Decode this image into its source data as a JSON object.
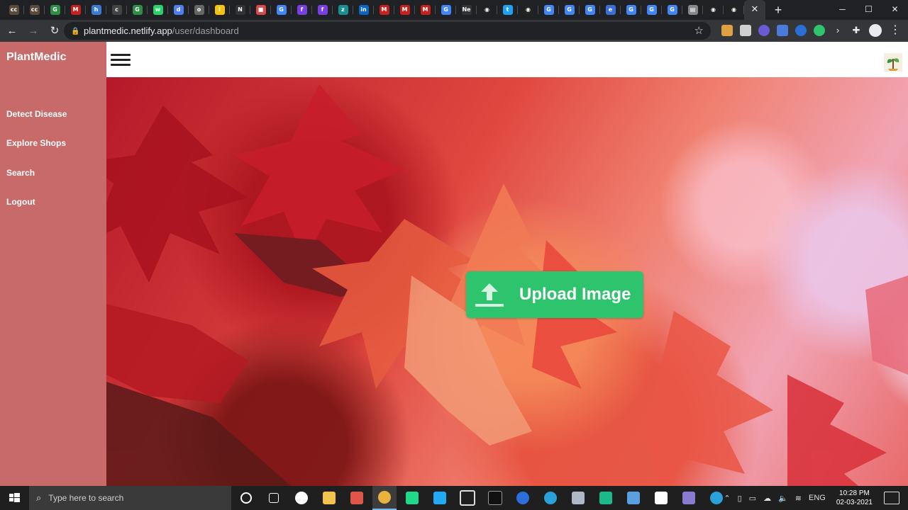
{
  "browser": {
    "active_tab_close": "✕",
    "new_tab": "+",
    "url_host": "plantmedic.netlify.app",
    "url_path": "/user/dashboard",
    "window_controls": [
      "─",
      "☐",
      "✕"
    ],
    "tab_favicons": [
      {
        "label": "cc",
        "color": "#5a4a3a"
      },
      {
        "label": "cc",
        "color": "#5a4a3a"
      },
      {
        "label": "G",
        "color": "#2f8d46"
      },
      {
        "label": "M",
        "color": "#c5221f"
      },
      {
        "label": "h",
        "color": "#3a7bd5"
      },
      {
        "label": "c",
        "color": "#444"
      },
      {
        "label": "G",
        "color": "#2f8d46"
      },
      {
        "label": "w",
        "color": "#25d366"
      },
      {
        "label": "d",
        "color": "#4f7df3"
      },
      {
        "label": "o",
        "color": "#666"
      },
      {
        "label": "i",
        "color": "#f4c20d"
      },
      {
        "label": "N",
        "color": "#333"
      },
      {
        "label": "■",
        "color": "#e04848"
      },
      {
        "label": "G",
        "color": "#4285f4"
      },
      {
        "label": "f",
        "color": "#7a3fe0"
      },
      {
        "label": "f",
        "color": "#7a3fe0"
      },
      {
        "label": "z",
        "color": "#1a8f8f"
      },
      {
        "label": "in",
        "color": "#0a66c2"
      },
      {
        "label": "M",
        "color": "#c5221f"
      },
      {
        "label": "M",
        "color": "#c5221f"
      },
      {
        "label": "M",
        "color": "#c5221f"
      },
      {
        "label": "G",
        "color": "#4285f4"
      },
      {
        "label": "Ne",
        "color": "#333"
      },
      {
        "label": "◉",
        "color": "#222"
      },
      {
        "label": "t",
        "color": "#1da1f2"
      },
      {
        "label": "◉",
        "color": "#222"
      },
      {
        "label": "G",
        "color": "#4285f4"
      },
      {
        "label": "G",
        "color": "#4285f4"
      },
      {
        "label": "G",
        "color": "#4285f4"
      },
      {
        "label": "e",
        "color": "#3b6fd8"
      },
      {
        "label": "G",
        "color": "#4285f4"
      },
      {
        "label": "G",
        "color": "#4285f4"
      },
      {
        "label": "G",
        "color": "#4285f4"
      },
      {
        "label": "▤",
        "color": "#888"
      },
      {
        "label": "◉",
        "color": "#222"
      },
      {
        "label": "◉",
        "color": "#222"
      }
    ]
  },
  "app": {
    "brand": "PlantMedic",
    "nav": [
      "Detect Disease",
      "Explore Shops",
      "Search",
      "Logout"
    ],
    "upload_label": "Upload Image",
    "colors": {
      "sidebar": "#c96a6a",
      "upload_button": "#2ec46d"
    }
  },
  "taskbar": {
    "search_placeholder": "Type here to search",
    "language": "ENG",
    "time": "10:28 PM",
    "date": "02-03-2021"
  }
}
